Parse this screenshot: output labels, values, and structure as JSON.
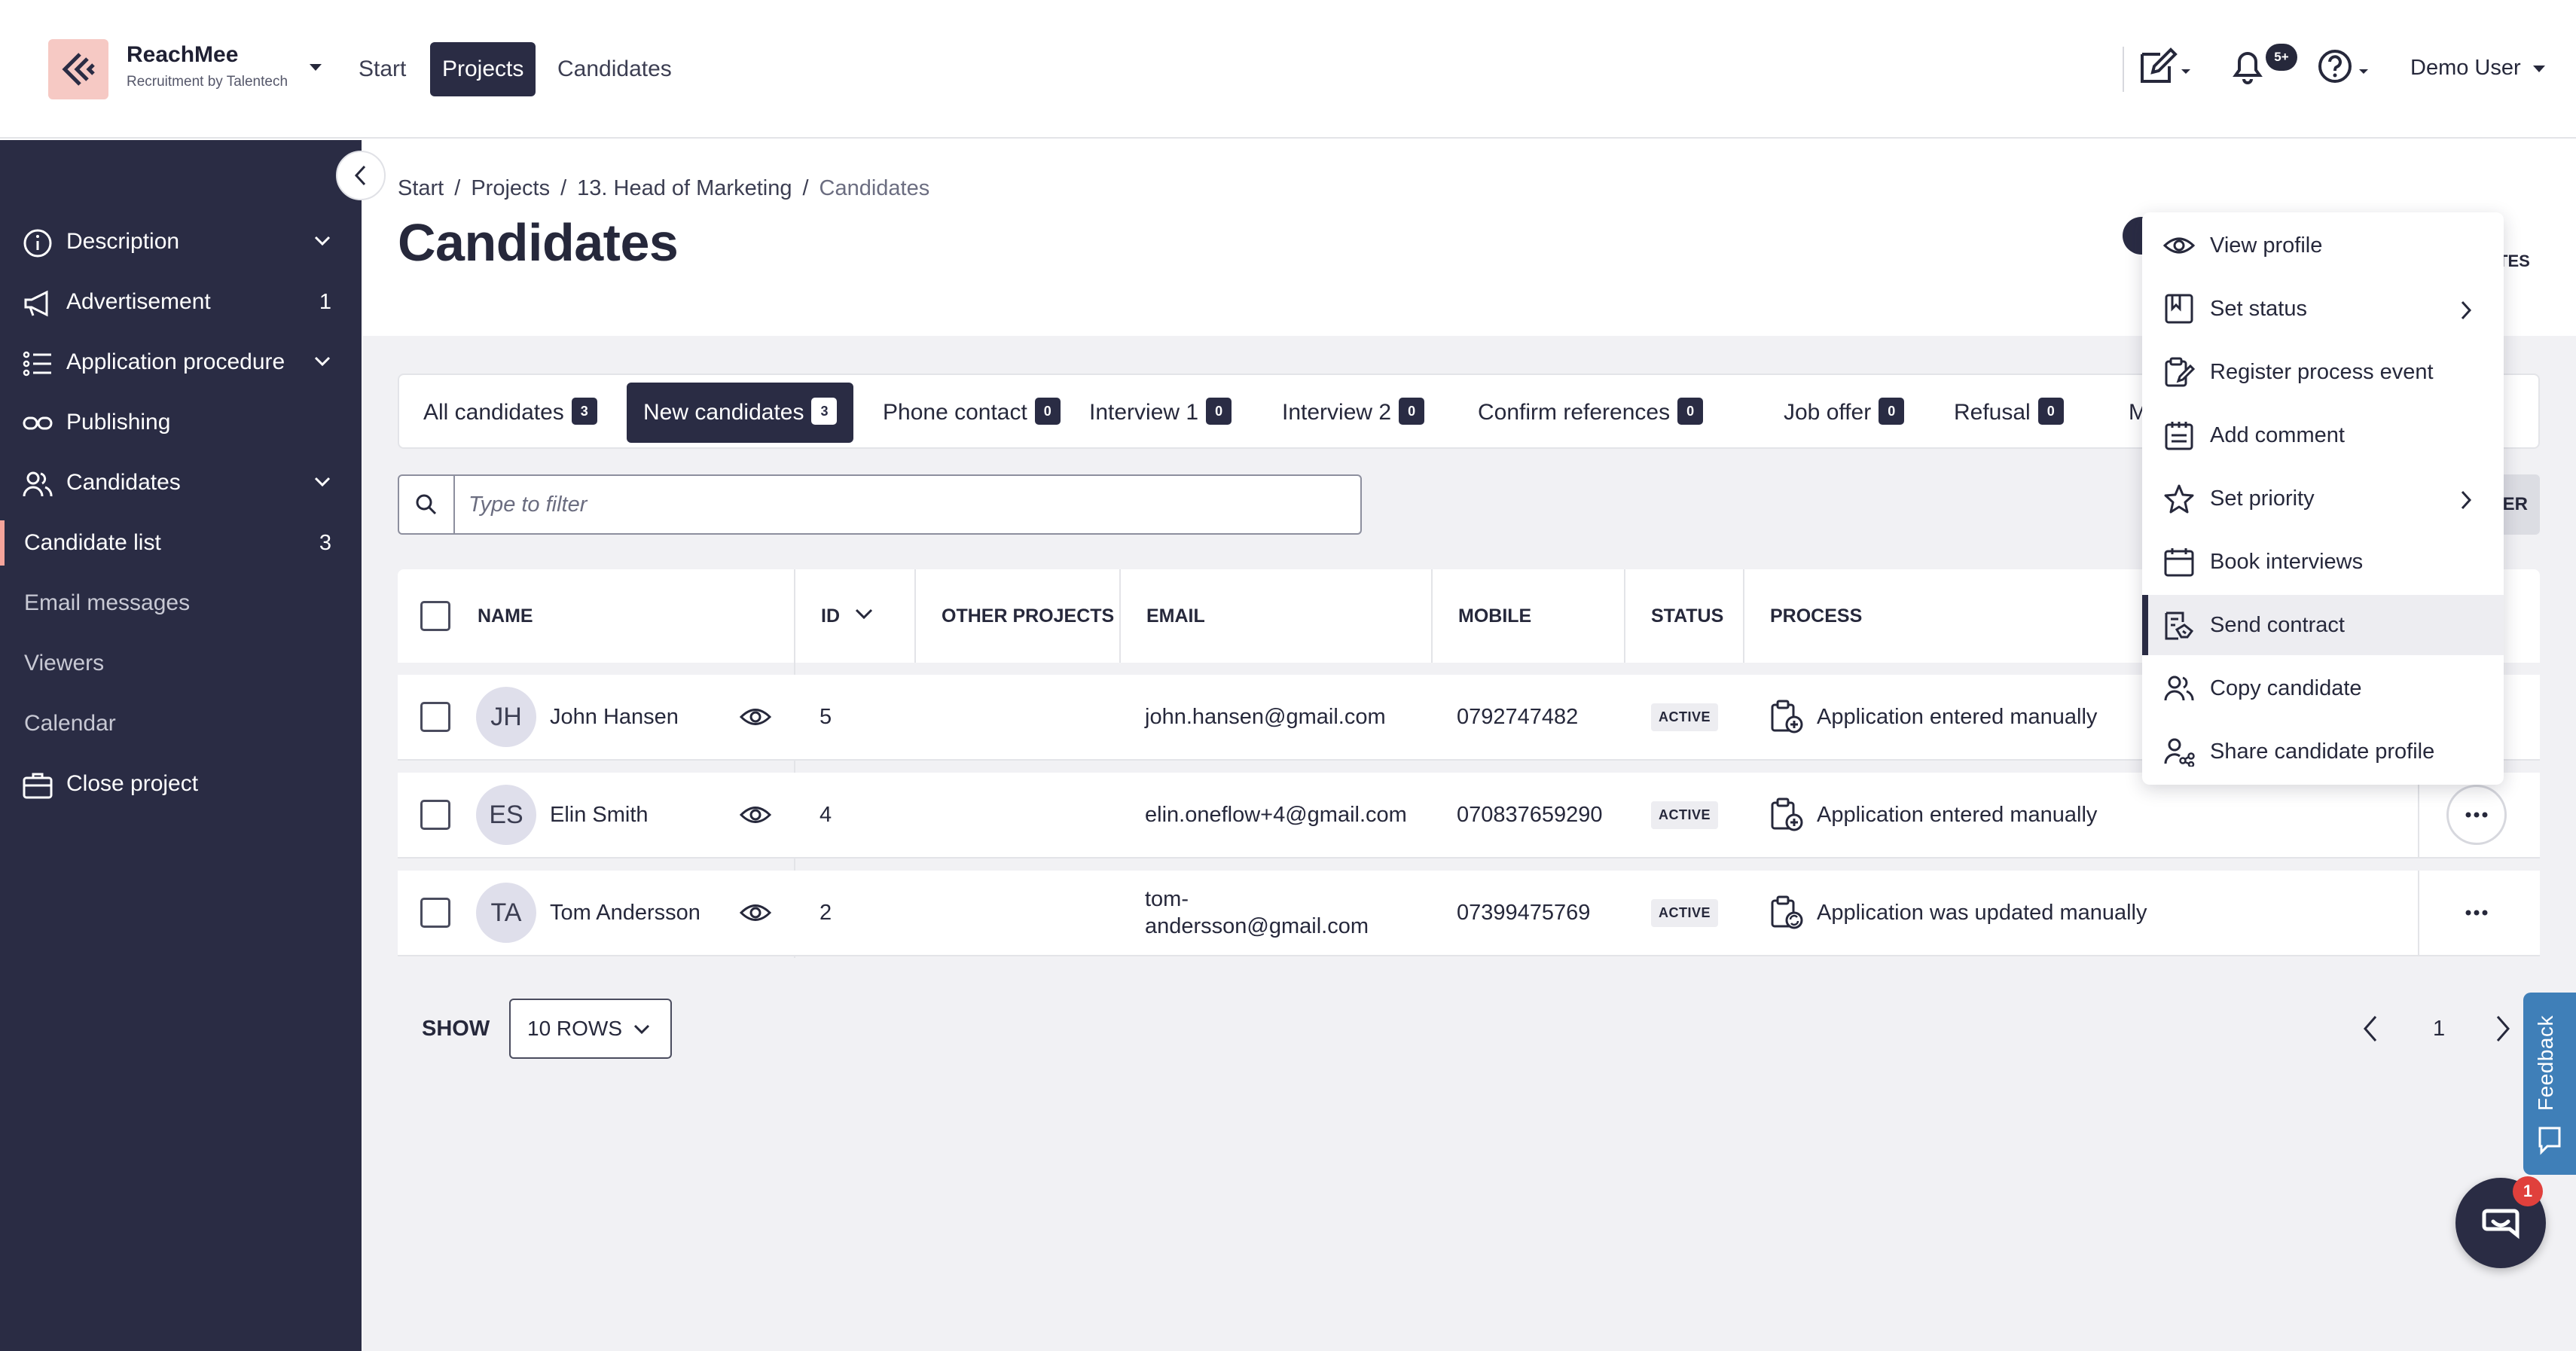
{
  "brand": {
    "name": "ReachMee",
    "subtitle": "Recruitment by Talentech"
  },
  "nav": {
    "start": "Start",
    "projects": "Projects",
    "candidates": "Candidates"
  },
  "header": {
    "notifications_badge": "5+",
    "user": "Demo User"
  },
  "sidebar": {
    "description": "Description",
    "advertisement": "Advertisement",
    "advertisement_count": "1",
    "application_procedure": "Application procedure",
    "publishing": "Publishing",
    "candidates": "Candidates",
    "candidate_list": "Candidate list",
    "candidate_list_count": "3",
    "email_messages": "Email messages",
    "viewers": "Viewers",
    "calendar": "Calendar",
    "close_project": "Close project"
  },
  "breadcrumb": [
    "Start",
    "Projects",
    "13. Head of Marketing",
    "Candidates"
  ],
  "page_title": "Candidates",
  "tabs": [
    {
      "label": "All candidates",
      "count": "3"
    },
    {
      "label": "New candidates",
      "count": "3"
    },
    {
      "label": "Phone contact",
      "count": "0"
    },
    {
      "label": "Interview 1",
      "count": "0"
    },
    {
      "label": "Interview 2",
      "count": "0"
    },
    {
      "label": "Confirm references",
      "count": "0"
    },
    {
      "label": "Job offer",
      "count": "0"
    },
    {
      "label": "Refusal",
      "count": "0"
    },
    {
      "label": "Mo"
    }
  ],
  "filter": {
    "placeholder": "Type to filter",
    "right_partial": "ER"
  },
  "behind_menu_text": "TES",
  "table": {
    "headers": {
      "name": "NAME",
      "id": "ID",
      "other_projects": "OTHER PROJECTS",
      "email": "EMAIL",
      "mobile": "MOBILE",
      "status": "STATUS",
      "process": "PROCESS"
    },
    "rows": [
      {
        "initials": "JH",
        "name": "John Hansen",
        "id": "5",
        "email": "john.hansen@gmail.com",
        "mobile": "0792747482",
        "status": "ACTIVE",
        "process": "Application entered manually"
      },
      {
        "initials": "ES",
        "name": "Elin Smith",
        "id": "4",
        "email": "elin.oneflow+4@gmail.com",
        "mobile": "070837659290",
        "status": "ACTIVE",
        "process": "Application entered manually"
      },
      {
        "initials": "TA",
        "name": "Tom Andersson",
        "id": "2",
        "email_line1": "tom-",
        "email_line2": "andersson@gmail.com",
        "mobile": "07399475769",
        "status": "ACTIVE",
        "process": "Application was updated manually"
      }
    ]
  },
  "show": {
    "label": "SHOW",
    "value": "10 ROWS"
  },
  "pagination": {
    "page": "1"
  },
  "feedback": {
    "label": "Feedback"
  },
  "help": {
    "badge": "1"
  },
  "context_menu": {
    "items": [
      {
        "label": "View profile",
        "icon": "eye-icon"
      },
      {
        "label": "Set status",
        "icon": "bookmark-icon",
        "submenu": true
      },
      {
        "label": "Register process event",
        "icon": "clipboard-edit-icon"
      },
      {
        "label": "Add comment",
        "icon": "notepad-icon"
      },
      {
        "label": "Set priority",
        "icon": "star-icon",
        "submenu": true
      },
      {
        "label": "Book interviews",
        "icon": "calendar-icon"
      },
      {
        "label": "Send contract",
        "icon": "contract-icon",
        "highlighted": true
      },
      {
        "label": "Copy candidate",
        "icon": "users-icon"
      },
      {
        "label": "Share candidate profile",
        "icon": "share-user-icon"
      }
    ]
  },
  "colors": {
    "sidebar_bg": "#2a2c44",
    "accent": "#2a2c44",
    "logo_bg": "#f6c9c4",
    "feedback": "#3f7fb8",
    "help_badge": "#e0403c"
  }
}
